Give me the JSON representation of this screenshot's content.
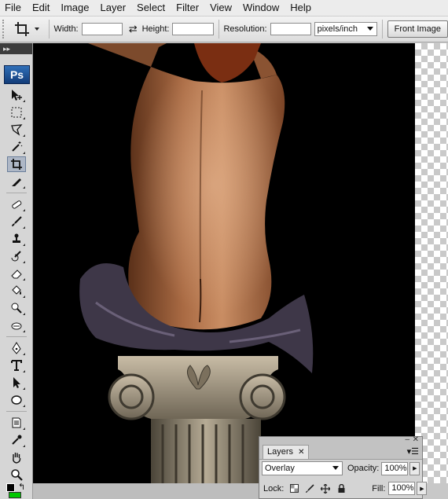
{
  "menubar": {
    "items": [
      "File",
      "Edit",
      "Image",
      "Layer",
      "Select",
      "Filter",
      "View",
      "Window",
      "Help"
    ]
  },
  "options_bar": {
    "width_label": "Width:",
    "width_value": "",
    "height_label": "Height:",
    "height_value": "",
    "resolution_label": "Resolution:",
    "resolution_value": "",
    "units_select": "pixels/inch",
    "front_image_button": "Front Image"
  },
  "toolbox": {
    "logo": "Ps",
    "active_tool": "crop-tool"
  },
  "layers_panel": {
    "tab_label": "Layers",
    "blend_mode": "Overlay",
    "opacity_label": "Opacity:",
    "opacity_value": "100%",
    "lock_label": "Lock:",
    "fill_label": "Fill:",
    "fill_value": "100%"
  },
  "colors": {
    "canvas_background": "#000000",
    "logo_blue": "#1f5aa6",
    "foreground_swatch": "#000000",
    "background_swatch": "#00c800"
  }
}
